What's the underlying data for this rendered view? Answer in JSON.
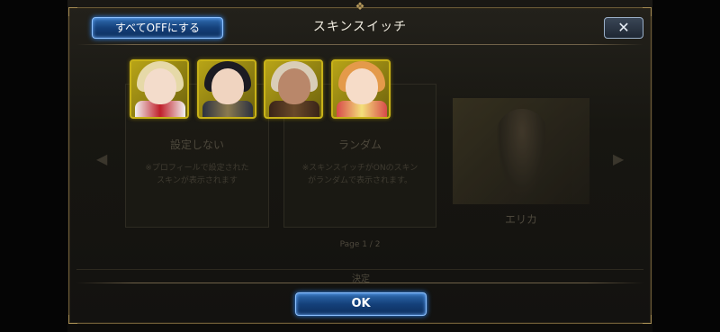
{
  "dialog": {
    "title": "スキンスイッチ",
    "all_off_label": "すべてOFFにする",
    "close_symbol": "✕",
    "ok_label": "OK"
  },
  "background_panel": {
    "cards": [
      {
        "title": "設定しない",
        "desc_line1": "※プロフィールで設定された",
        "desc_line2": "スキンが表示されます"
      },
      {
        "title": "ランダム",
        "desc_line1": "※スキンスイッチがONのスキン",
        "desc_line2": "がランダムで表示されます。"
      }
    ],
    "character_name": "エリカ",
    "page_label": "Page 1 / 2",
    "decide_label": "決定"
  },
  "selected_skins": [
    {
      "name": "skin-1",
      "hair": "#e6d9a8",
      "skin": "#f3dccb",
      "body": "#f1f1f1",
      "accent": "#c0202a"
    },
    {
      "name": "skin-2",
      "hair": "#1c1b22",
      "skin": "#f0d4c0",
      "body": "#2c3140",
      "accent": "#8a7a50"
    },
    {
      "name": "skin-3",
      "hair": "#d9cdb8",
      "skin": "#b9876a",
      "body": "#3a2418",
      "accent": "#6a4a2a"
    },
    {
      "name": "skin-4",
      "hair": "#e49a4a",
      "skin": "#f6dcc8",
      "body": "#d84a4a",
      "accent": "#f3e07a"
    }
  ],
  "colors": {
    "button_blue": "#14407a",
    "selection_yellow": "#c8b218",
    "frame_gold": "#6b5a36"
  }
}
